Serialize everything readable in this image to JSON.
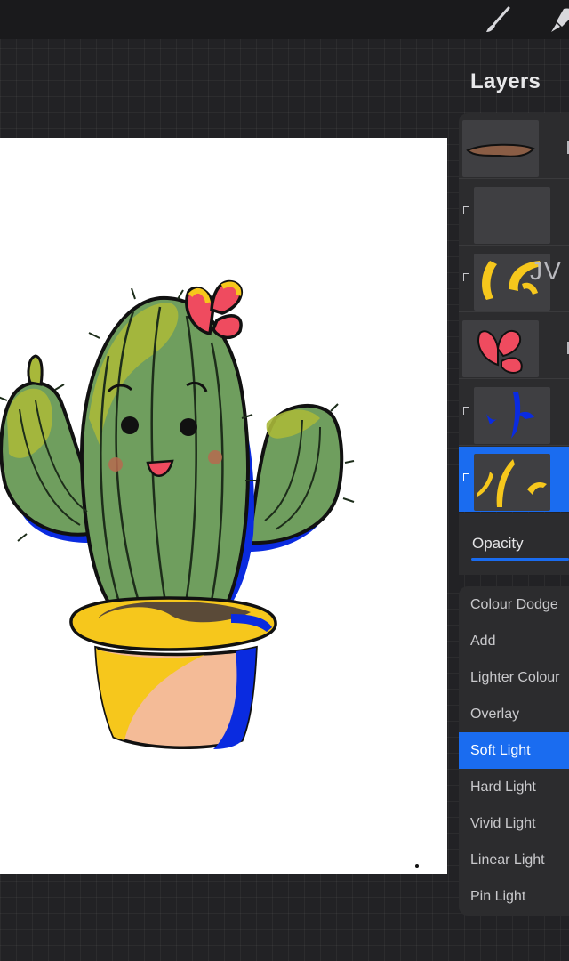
{
  "toolbar": {
    "icons": [
      "paint-brush-icon",
      "smudge-icon"
    ]
  },
  "layers_panel": {
    "title": "Layers",
    "layers": [
      {
        "thumb": "mouth-stroke",
        "clipped": false,
        "selected": false
      },
      {
        "thumb": "empty",
        "clipped": true,
        "selected": false
      },
      {
        "thumb": "yellow-strokes",
        "clipped": true,
        "selected": false,
        "label_fragment": "JV"
      },
      {
        "thumb": "red-flower",
        "clipped": false,
        "selected": false
      },
      {
        "thumb": "blue-strokes",
        "clipped": true,
        "selected": false
      },
      {
        "thumb": "yellow-strokes-small",
        "clipped": true,
        "selected": true
      }
    ]
  },
  "opacity": {
    "label": "Opacity",
    "value": 1.0
  },
  "blend_modes": {
    "items": [
      "Colour Dodge",
      "Add",
      "Lighter Colour",
      "Overlay",
      "Soft Light",
      "Hard Light",
      "Vivid Light",
      "Linear Light",
      "Pin Light"
    ],
    "selected": "Soft Light"
  },
  "colors": {
    "accent": "#1a6cf0",
    "panel": "#2c2c2e",
    "canvas": "#ffffff",
    "cactus_green": "#6f9e5e",
    "cactus_highlight": "#a8b83a",
    "shadow_blue": "#0a2be0",
    "pot_peach": "#f4bb97",
    "pot_yellow": "#f6c71c",
    "flower_red": "#ef4b5f"
  }
}
